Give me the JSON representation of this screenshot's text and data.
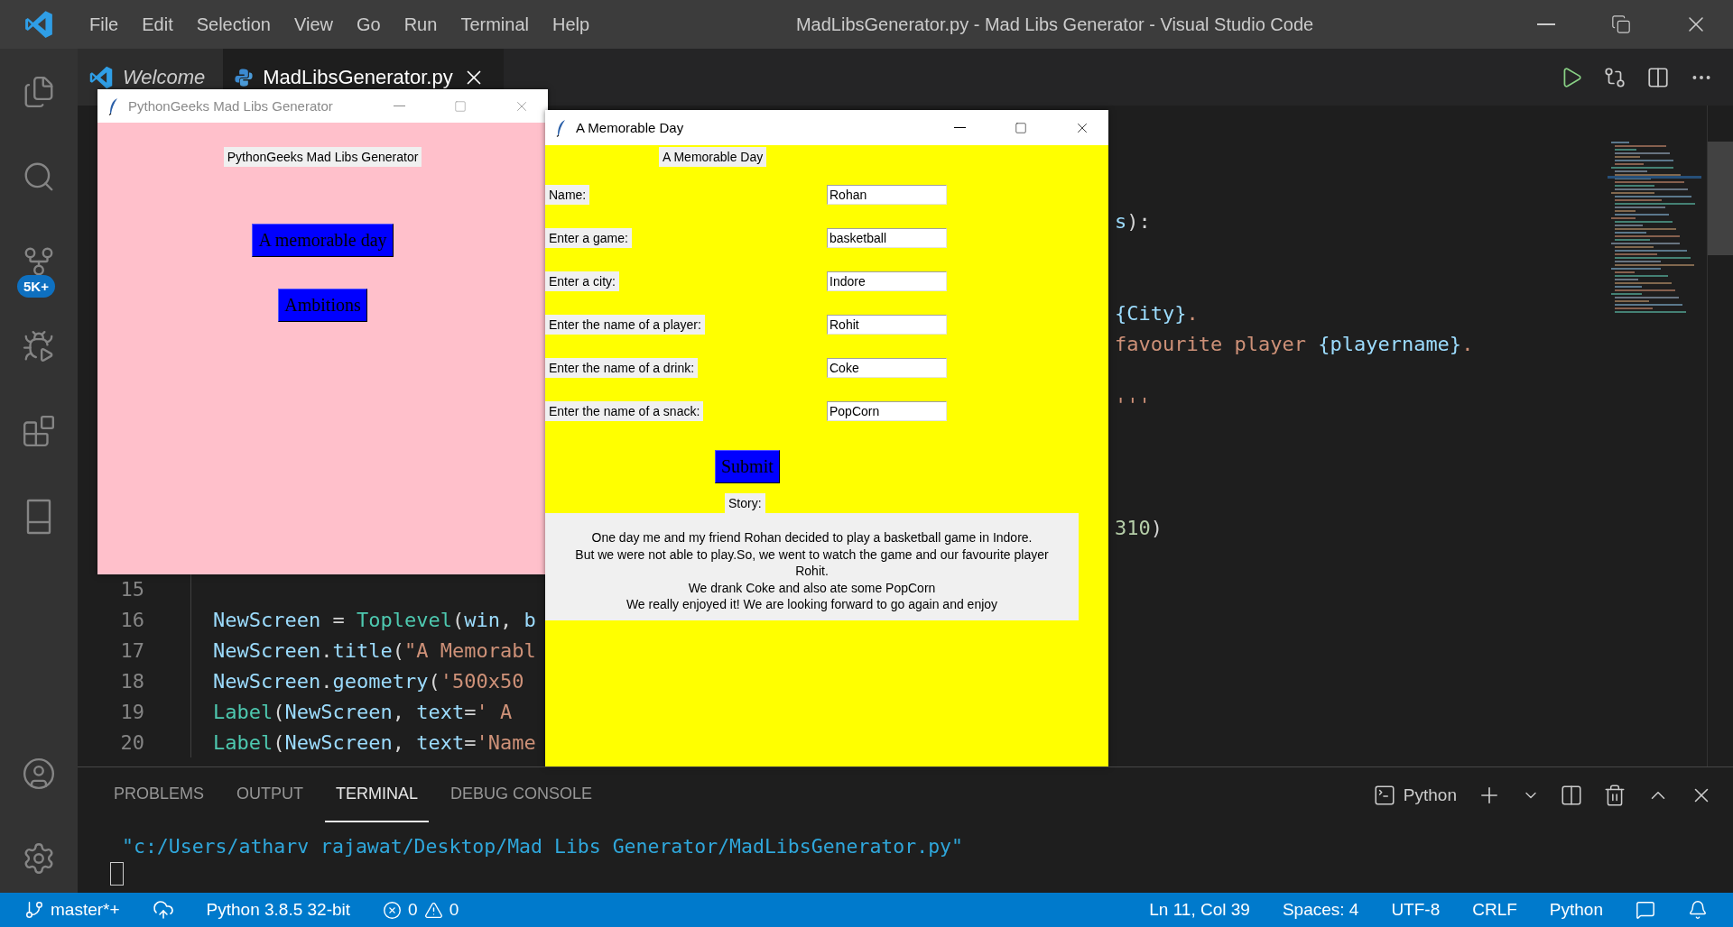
{
  "window": {
    "title": "MadLibsGenerator.py - Mad Libs Generator - Visual Studio Code"
  },
  "menu": [
    "File",
    "Edit",
    "Selection",
    "View",
    "Go",
    "Run",
    "Terminal",
    "Help"
  ],
  "activity_bar": {
    "top": [
      {
        "kind": "explorer"
      },
      {
        "kind": "search"
      },
      {
        "kind": "source_control",
        "badge": "5K+"
      },
      {
        "kind": "run_debug"
      },
      {
        "kind": "extensions"
      },
      {
        "kind": "notebook"
      }
    ],
    "bottom": [
      {
        "kind": "accounts"
      },
      {
        "kind": "manage"
      }
    ]
  },
  "tabs": [
    {
      "label": "Welcome",
      "kind": "welcome",
      "selected": false,
      "preview": true
    },
    {
      "label": "MadLibsGenerator.py",
      "kind": "python",
      "selected": true,
      "preview": false
    }
  ],
  "editor": {
    "fragments": [
      {
        "code": [
          {
            "text": "s",
            "kind": "variable"
          },
          {
            "text": "):",
            "kind": "plain"
          }
        ]
      },
      {
        "code": [
          {
            "text": "{City}",
            "kind": "variable"
          },
          {
            "text": ".",
            "kind": "string"
          }
        ]
      },
      {
        "code": [
          {
            "text": "favourite player ",
            "kind": "string"
          },
          {
            "text": "{playername}",
            "kind": "variable"
          },
          {
            "text": ".",
            "kind": "string"
          }
        ]
      },
      {
        "code": [
          {
            "text": "'''",
            "kind": "string"
          }
        ]
      },
      {
        "code": [
          {
            "text": "310",
            "kind": "number"
          },
          {
            "text": ")",
            "kind": "plain"
          }
        ]
      }
    ],
    "lines": [
      {
        "number": "15"
      },
      {
        "number": "16",
        "code": [
          {
            "text": "NewScreen",
            "kind": "variable"
          },
          {
            "text": " = ",
            "kind": "plain"
          },
          {
            "text": "Toplevel",
            "kind": "class"
          },
          {
            "text": "(",
            "kind": "plain"
          },
          {
            "text": "win",
            "kind": "variable"
          },
          {
            "text": ", ",
            "kind": "plain"
          },
          {
            "text": "b",
            "kind": "variable"
          }
        ]
      },
      {
        "number": "17",
        "code": [
          {
            "text": "NewScreen",
            "kind": "variable"
          },
          {
            "text": ".",
            "kind": "plain"
          },
          {
            "text": "title",
            "kind": "variable"
          },
          {
            "text": "(",
            "kind": "plain"
          },
          {
            "text": "\"A Memorabl",
            "kind": "string"
          }
        ]
      },
      {
        "number": "18",
        "code": [
          {
            "text": "NewScreen",
            "kind": "variable"
          },
          {
            "text": ".",
            "kind": "plain"
          },
          {
            "text": "geometry",
            "kind": "variable"
          },
          {
            "text": "(",
            "kind": "plain"
          },
          {
            "text": "'500x50",
            "kind": "string"
          }
        ]
      },
      {
        "number": "19",
        "code": [
          {
            "text": "Label",
            "kind": "class"
          },
          {
            "text": "(",
            "kind": "plain"
          },
          {
            "text": "NewScreen",
            "kind": "variable"
          },
          {
            "text": ", ",
            "kind": "plain"
          },
          {
            "text": "text",
            "kind": "variable"
          },
          {
            "text": "=",
            "kind": "plain"
          },
          {
            "text": "' A",
            "kind": "string"
          }
        ]
      },
      {
        "number": "20",
        "code": [
          {
            "text": "Label",
            "kind": "class"
          },
          {
            "text": "(",
            "kind": "plain"
          },
          {
            "text": "NewScreen",
            "kind": "variable"
          },
          {
            "text": ", ",
            "kind": "plain"
          },
          {
            "text": "text",
            "kind": "variable"
          },
          {
            "text": "=",
            "kind": "plain"
          },
          {
            "text": "'Name",
            "kind": "string"
          }
        ]
      }
    ]
  },
  "main_window": {
    "title": "PythonGeeks Mad Libs Generator",
    "active": false,
    "heading": "PythonGeeks Mad Libs Generator",
    "buttons": [
      "A memorable day",
      "Ambitions"
    ]
  },
  "story_window": {
    "title": "A Memorable Day",
    "active": true,
    "heading": "A Memorable Day",
    "fields": [
      {
        "label": "Name:",
        "value": "Rohan"
      },
      {
        "label": "Enter a game:",
        "value": "basketball"
      },
      {
        "label": "Enter a city:",
        "value": "Indore"
      },
      {
        "label": "Enter the name of a player:",
        "value": "Rohit"
      },
      {
        "label": "Enter the name of a drink:",
        "value": "Coke"
      },
      {
        "label": "Enter the name of a snack:",
        "value": "PopCorn"
      }
    ],
    "submit": "Submit",
    "story_label": "Story:",
    "story": [
      "One day me and my friend Rohan decided to play a basketball game in Indore.",
      "But we were not able to play.So, we went to watch the game and our favourite player",
      "Rohit.",
      "We drank Coke and also ate some PopCorn",
      "We really enjoyed it! We are looking forward to go again and enjoy"
    ]
  },
  "panel": {
    "tabs": [
      {
        "label": "PROBLEMS",
        "selected": false
      },
      {
        "label": "OUTPUT",
        "selected": false
      },
      {
        "label": "TERMINAL",
        "selected": true
      },
      {
        "label": "DEBUG CONSOLE",
        "selected": false
      }
    ],
    "shell": "Python",
    "output": [
      "\"c:/Users/atharv rajawat/Desktop/Mad Libs Generator/MadLibsGenerator.py\""
    ]
  },
  "status_bar": {
    "branch": "master*+",
    "interpreter": "Python 3.8.5 32-bit",
    "errors": "0",
    "warnings": "0",
    "position": "Ln 11, Col 39",
    "indent": "Spaces: 4",
    "encoding": "UTF-8",
    "eol": "CRLF",
    "language": "Python"
  }
}
